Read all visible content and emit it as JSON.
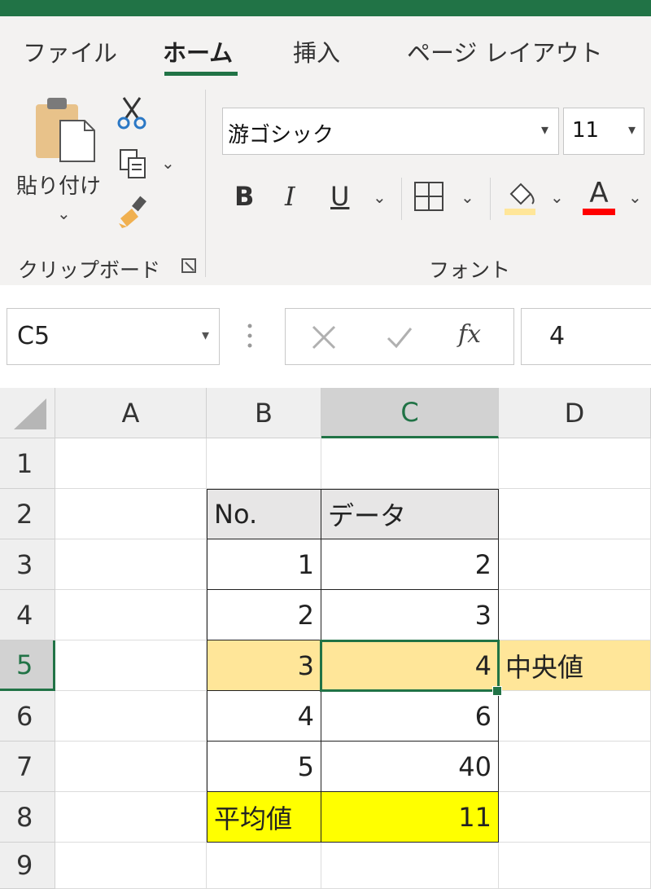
{
  "ribbon": {
    "tabs": [
      "ファイル",
      "ホーム",
      "挿入",
      "ページ レイアウト"
    ],
    "clipboard": {
      "paste_label": "貼り付け",
      "group_label": "クリップボード"
    },
    "font": {
      "font_name": "游ゴシック",
      "font_size": "11",
      "group_label": "フォント",
      "bold": "B",
      "italic": "I",
      "underline": "U",
      "font_color_glyph": "A"
    },
    "colors": {
      "accent": "#217346",
      "fill_swatch": "#ffe699",
      "font_color_swatch": "#ff0000"
    }
  },
  "formula_bar": {
    "name_box": "C5",
    "fx": "fx",
    "value": "4"
  },
  "sheet": {
    "columns": [
      "A",
      "B",
      "C",
      "D"
    ],
    "rows": [
      "1",
      "2",
      "3",
      "4",
      "5",
      "6",
      "7",
      "8",
      "9"
    ],
    "header_row": {
      "b": "No.",
      "c": "データ"
    },
    "data": [
      {
        "b": "1",
        "c": "2"
      },
      {
        "b": "2",
        "c": "3"
      },
      {
        "b": "3",
        "c": "4"
      },
      {
        "b": "4",
        "c": "6"
      },
      {
        "b": "5",
        "c": "40"
      }
    ],
    "summary": {
      "b": "平均値",
      "c": "11"
    },
    "median_label": "中央値",
    "selected_cell": "C5",
    "colors": {
      "median_fill": "#ffe699",
      "average_fill": "#ffff00",
      "header_fill": "#e7e6e6"
    }
  }
}
